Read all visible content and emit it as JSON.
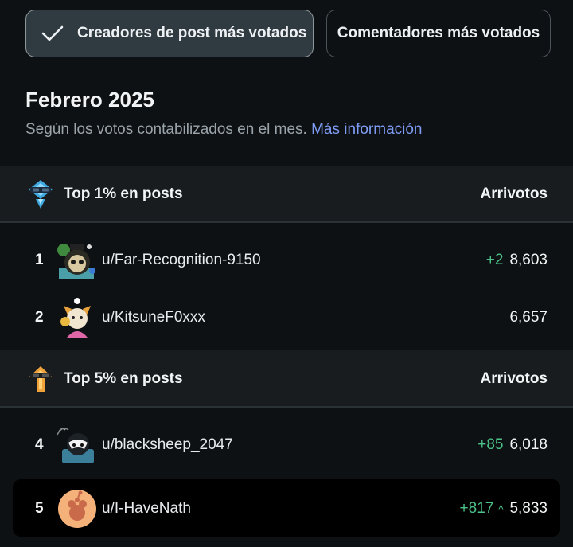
{
  "tabs": [
    {
      "label": "Creadores de post más votados",
      "active": true
    },
    {
      "label": "Comentadores más votados",
      "active": false
    }
  ],
  "period_title": "Febrero 2025",
  "subtitle": {
    "text": "Según los votos contabilizados en el mes.",
    "link": "Más información"
  },
  "sections": [
    {
      "label": "Top 1% en posts",
      "column": "Arrivotos",
      "badge_icon": "diamond-badge-icon",
      "rows": [
        {
          "rank": "1",
          "username": "u/Far-Recognition-9150",
          "delta": "+2",
          "score": "8,603"
        },
        {
          "rank": "2",
          "username": "u/KitsuneF0xxx",
          "delta": "",
          "score": "6,657"
        }
      ]
    },
    {
      "label": "Top 5% en posts",
      "column": "Arrivotos",
      "badge_icon": "gold-badge-icon",
      "rows": [
        {
          "rank": "4",
          "username": "u/blacksheep_2047",
          "delta": "+85",
          "score": "6,018"
        },
        {
          "rank": "5",
          "username": "u/I-HaveNath",
          "delta": "+817",
          "score": "5,833",
          "highlighted": true
        }
      ]
    }
  ],
  "colors": {
    "background": "#0e1113",
    "section_header": "#181c1f",
    "active_tab": "#303b41",
    "link": "#7f9cf5",
    "positive_delta": "#4cc38a"
  }
}
